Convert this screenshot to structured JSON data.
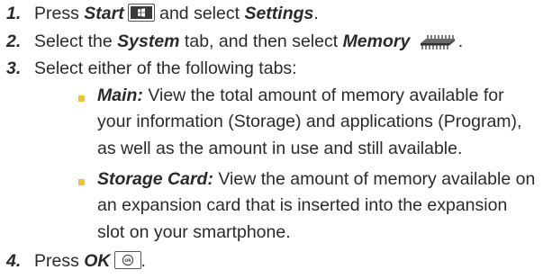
{
  "steps": [
    {
      "number": "1.",
      "part1": "Press ",
      "start_label": "Start",
      "part2": " and select ",
      "settings_label": "Settings",
      "part3": "."
    },
    {
      "number": "2.",
      "part1": "Select the ",
      "system_label": "System",
      "part2": " tab, and then select ",
      "memory_label": "Memory",
      "part3": "."
    },
    {
      "number": "3.",
      "text": "Select either of the following tabs:"
    },
    {
      "number": "4.",
      "part1": "Press ",
      "ok_label": "OK",
      "part2": "."
    }
  ],
  "tabs": [
    {
      "label": "Main:",
      "lines": [
        " View the total amount of memory available for",
        "your information (Storage) and applications (Program),",
        "as well as the amount in use and still available."
      ]
    },
    {
      "label": "Storage Card:",
      "lines": [
        " View the amount of memory available on",
        "an expansion card that is inserted into the expansion",
        "slot on your smartphone."
      ]
    }
  ],
  "icons": {
    "start_key": "windows-start-key-icon",
    "memory": "memory-chip-icon",
    "ok_key": "ok-key-icon"
  },
  "colors": {
    "text": "#2a2a2a",
    "bullet": "#f2c230"
  }
}
